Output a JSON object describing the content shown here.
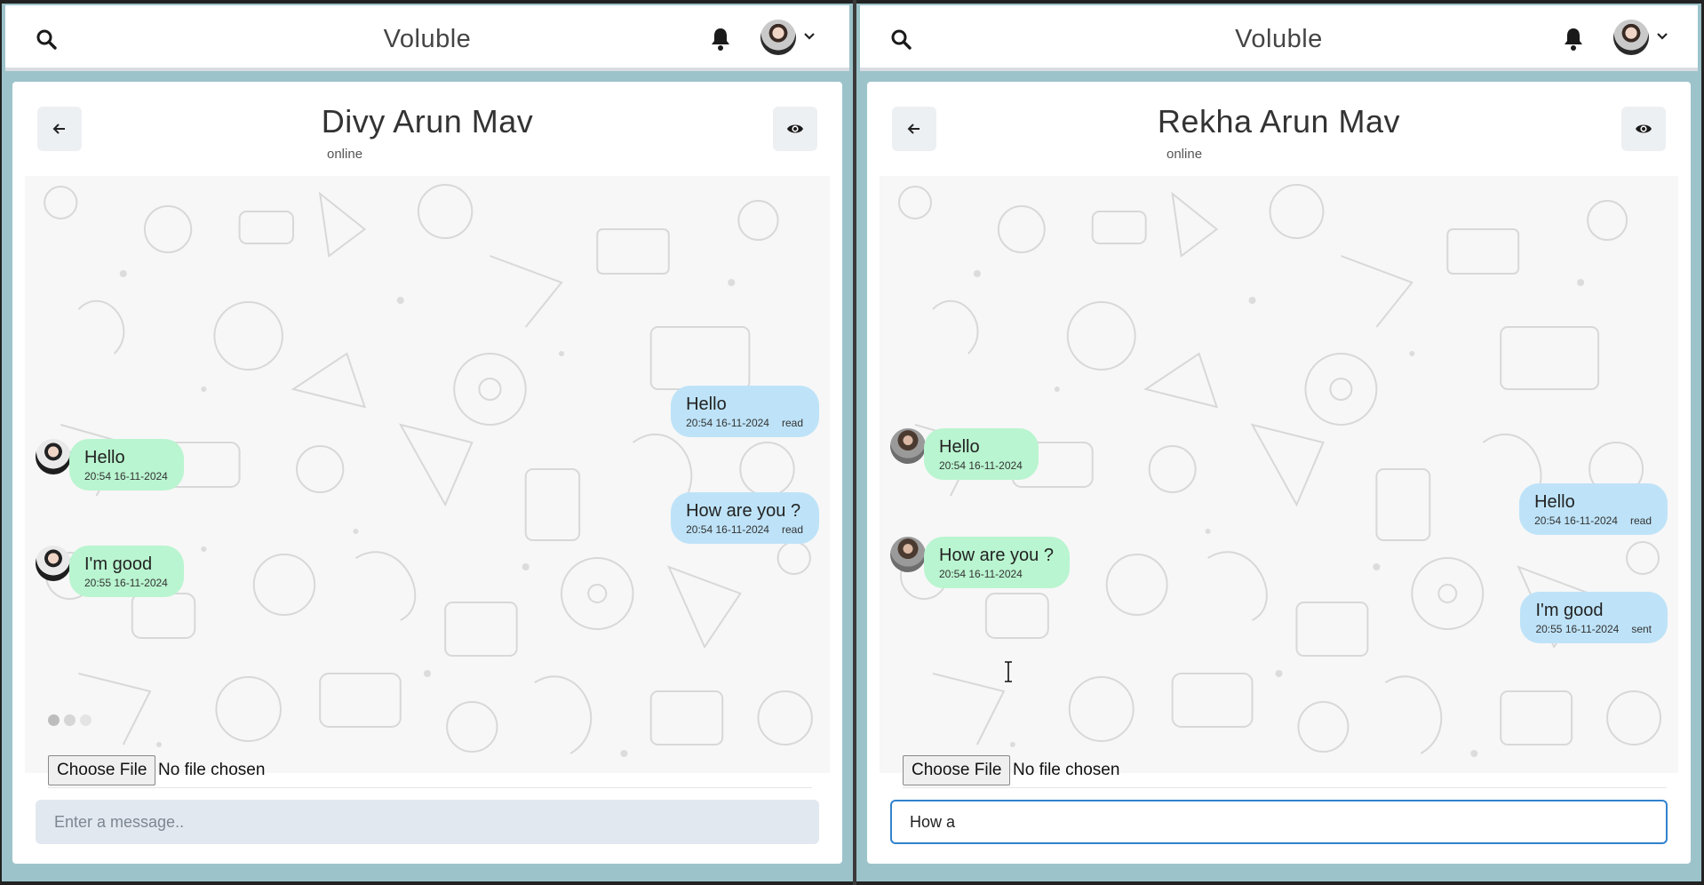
{
  "panes": [
    {
      "brand": "Voluble",
      "contact": {
        "name": "Divy Arun Mav",
        "status": "online"
      },
      "file": {
        "button": "Choose File",
        "label": "No file chosen"
      },
      "input": {
        "placeholder": "Enter a message..",
        "value": ""
      },
      "messages": [
        {
          "dir": "out",
          "text": "Hello",
          "time": "20:54 16-11-2024",
          "status": "read"
        },
        {
          "dir": "in",
          "text": "Hello",
          "time": "20:54 16-11-2024",
          "status": ""
        },
        {
          "dir": "out",
          "text": "How are you ?",
          "time": "20:54 16-11-2024",
          "status": "read"
        },
        {
          "dir": "in",
          "text": "I'm good",
          "time": "20:55 16-11-2024",
          "status": ""
        }
      ]
    },
    {
      "brand": "Voluble",
      "contact": {
        "name": "Rekha Arun Mav",
        "status": "online"
      },
      "file": {
        "button": "Choose File",
        "label": "No file chosen"
      },
      "input": {
        "placeholder": "Enter a message..",
        "value": "How a"
      },
      "messages": [
        {
          "dir": "in",
          "text": "Hello",
          "time": "20:54 16-11-2024",
          "status": ""
        },
        {
          "dir": "out",
          "text": "Hello",
          "time": "20:54 16-11-2024",
          "status": "read"
        },
        {
          "dir": "in",
          "text": "How are you ?",
          "time": "20:54 16-11-2024",
          "status": ""
        },
        {
          "dir": "out",
          "text": "I'm good",
          "time": "20:55 16-11-2024",
          "status": "sent"
        }
      ]
    }
  ],
  "colors": {
    "outgoing_bubble": "#bee3f8",
    "incoming_bubble": "#b9f5d0",
    "frame": "#9cc3ca",
    "focus_ring": "#3182ce"
  },
  "icons": [
    "search-icon",
    "bell-icon",
    "chevron-down-icon",
    "arrow-left-icon",
    "eye-icon",
    "text-cursor-icon"
  ]
}
